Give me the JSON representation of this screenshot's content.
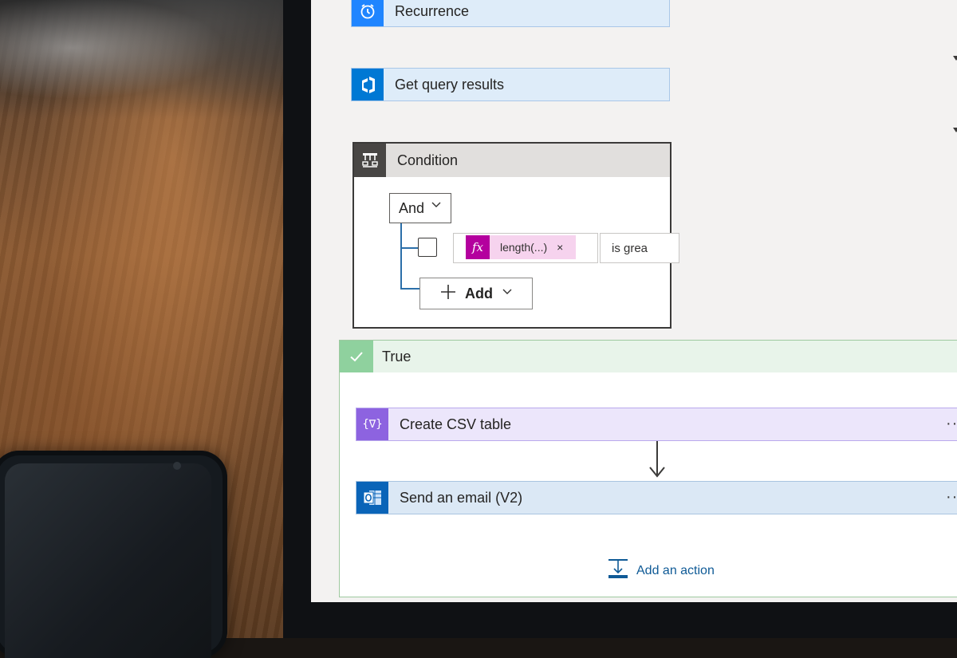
{
  "flow": {
    "recurrence": {
      "title": "Recurrence",
      "icon": "alarm-clock-icon"
    },
    "query": {
      "title": "Get query results",
      "icon": "devops-icon"
    },
    "condition": {
      "title": "Condition",
      "icon": "condition-icon",
      "group_operator": "And",
      "row": {
        "expression_token": "length(...)",
        "token_remove": "×",
        "operator": "is grea",
        "fx_label": "fx"
      },
      "add_label": "Add"
    },
    "true_branch": {
      "title": "True",
      "actions": [
        {
          "title": "Create CSV table",
          "icon": "data-operation-icon",
          "icon_text": "{∇}",
          "more": "···"
        },
        {
          "title": "Send an email (V2)",
          "icon": "outlook-icon",
          "more": "···"
        }
      ],
      "add_action_label": "Add an action"
    }
  },
  "colors": {
    "accent_blue": "#0078d4",
    "condition_gray": "#484644",
    "true_green": "#8fd19e",
    "csv_purple": "#8d63e0",
    "expression_magenta": "#b4009e"
  }
}
